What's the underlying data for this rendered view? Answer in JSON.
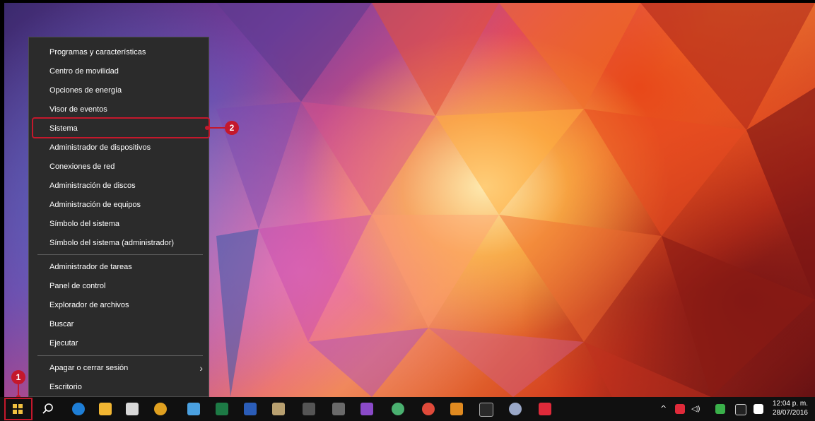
{
  "menu": {
    "group1": [
      "Programas y características",
      "Centro de movilidad",
      "Opciones de energía",
      "Visor de eventos",
      "Sistema",
      "Administrador de dispositivos",
      "Conexiones de red",
      "Administración de discos",
      "Administración de equipos",
      "Símbolo del sistema",
      "Símbolo del sistema (administrador)"
    ],
    "group2": [
      "Administrador de tareas",
      "Panel de control",
      "Explorador de archivos",
      "Buscar",
      "Ejecutar"
    ],
    "group3": [
      "Apagar o cerrar sesión",
      "Escritorio"
    ],
    "submenu_chevron": "›"
  },
  "callouts": {
    "one": "1",
    "two": "2"
  },
  "taskbar": {
    "icons": [
      "start-icon",
      "search-icon",
      "edge-icon",
      "file-explorer-icon",
      "store-icon",
      "app-infinity-icon",
      "cube-3d-icon",
      "excel-icon",
      "word-icon",
      "paint-icon",
      "f8-app-icon",
      "visual-studio-box-icon",
      "visual-studio-icon",
      "atom-icon",
      "chrome-icon",
      "media-player-icon",
      "cmd-icon",
      "app-circle-icon",
      "app-p-icon"
    ],
    "clock_time": "12:04 p. m.",
    "clock_date": "28/07/2016"
  },
  "colors": {
    "highlight": "#c4182c",
    "menu_bg": "#2b2b2b",
    "taskbar_bg": "#101010"
  }
}
